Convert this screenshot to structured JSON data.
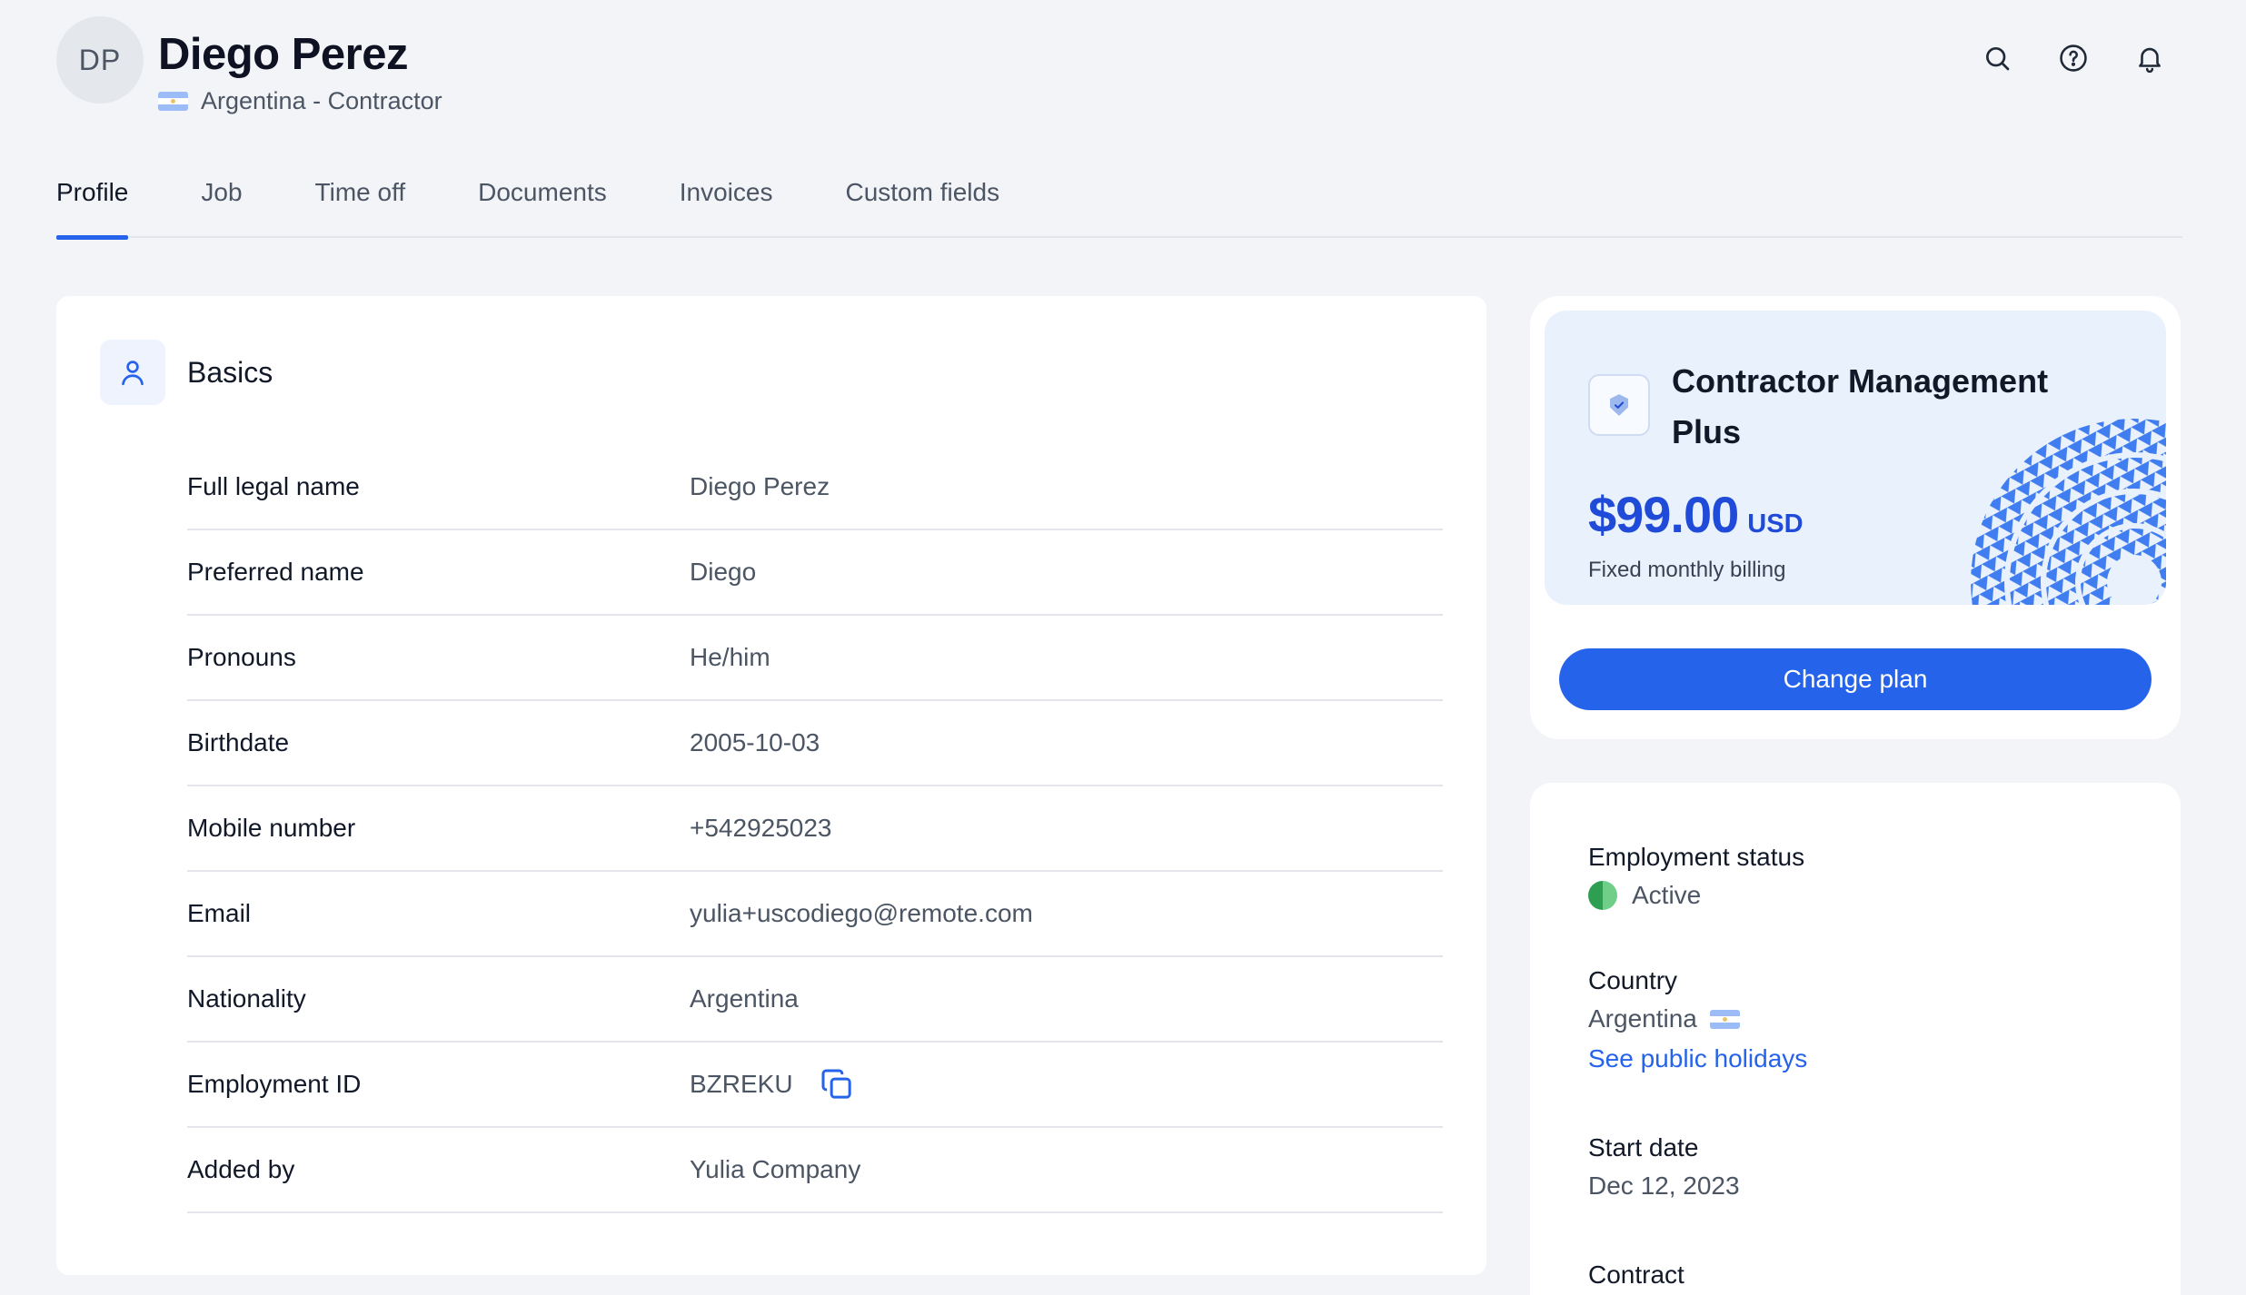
{
  "header": {
    "initials": "DP",
    "name": "Diego Perez",
    "subtitle": "Argentina - Contractor"
  },
  "tabs": [
    {
      "label": "Profile",
      "active": true
    },
    {
      "label": "Job"
    },
    {
      "label": "Time off"
    },
    {
      "label": "Documents"
    },
    {
      "label": "Invoices"
    },
    {
      "label": "Custom fields"
    }
  ],
  "basics": {
    "title": "Basics",
    "rows": [
      {
        "label": "Full legal name",
        "value": "Diego Perez"
      },
      {
        "label": "Preferred name",
        "value": "Diego"
      },
      {
        "label": "Pronouns",
        "value": "He/him"
      },
      {
        "label": "Birthdate",
        "value": "2005-10-03"
      },
      {
        "label": "Mobile number",
        "value": "+542925023"
      },
      {
        "label": "Email",
        "value": "yulia+uscodiego@remote.com"
      },
      {
        "label": "Nationality",
        "value": "Argentina"
      },
      {
        "label": "Employment ID",
        "value": "BZREKU"
      },
      {
        "label": "Added by",
        "value": "Yulia Company"
      }
    ]
  },
  "plan": {
    "name": "Contractor Management Plus",
    "amount": "$99.00",
    "currency": "USD",
    "billing": "Fixed monthly billing",
    "button": "Change plan"
  },
  "details": {
    "employment_status_label": "Employment status",
    "employment_status_value": "Active",
    "country_label": "Country",
    "country_value": "Argentina",
    "holidays_link": "See public holidays",
    "start_date_label": "Start date",
    "start_date_value": "Dec 12, 2023",
    "contract_label": "Contract"
  },
  "colors": {
    "accent": "#2563eb",
    "background": "#f3f4f8",
    "status_active": "#2e9e50"
  },
  "icons": [
    "search-icon",
    "help-icon",
    "bell-icon",
    "user-icon",
    "copy-icon",
    "shield-icon",
    "argentina-flag-icon"
  ]
}
